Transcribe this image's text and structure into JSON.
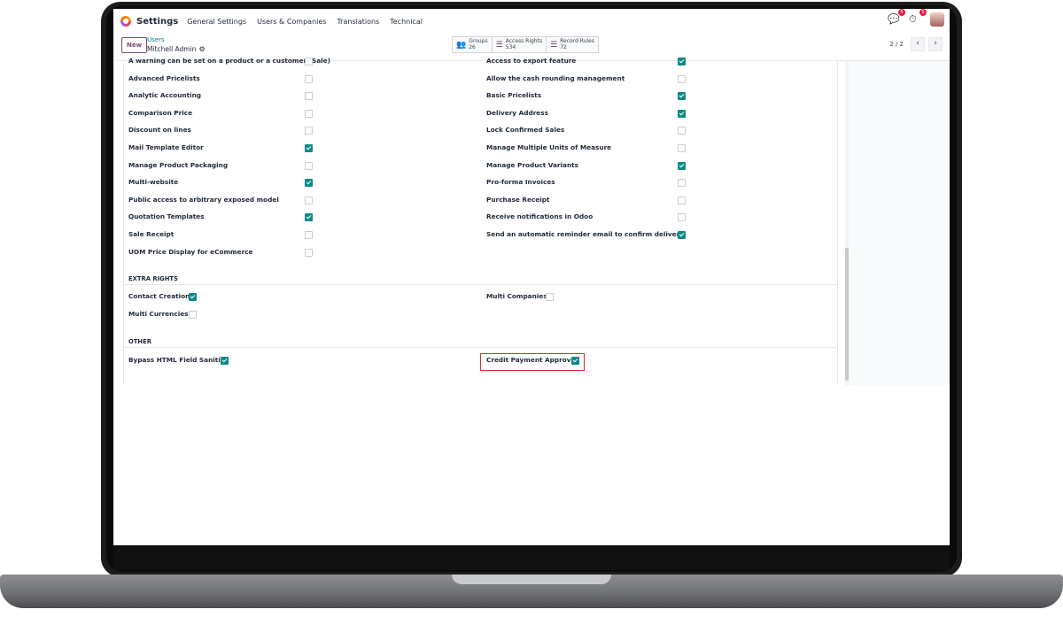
{
  "navbar": {
    "app_title": "Settings",
    "links": [
      "General Settings",
      "Users & Companies",
      "Translations",
      "Technical"
    ],
    "messages_badge": "5",
    "activity_badge": "5"
  },
  "control": {
    "new_button": "New",
    "breadcrumb": "Users",
    "record_name": "Mitchell Admin",
    "stats": [
      {
        "label": "Groups",
        "value": "26"
      },
      {
        "label": "Access Rights",
        "value": "534"
      },
      {
        "label": "Record Rules",
        "value": "72"
      }
    ],
    "pager": "2 / 2"
  },
  "technical_left": [
    {
      "label": "A warning can be set on a product or a customer (Sale)",
      "checked": false
    },
    {
      "label": "Advanced Pricelists",
      "checked": false
    },
    {
      "label": "Analytic Accounting",
      "checked": false
    },
    {
      "label": "Comparison Price",
      "checked": false
    },
    {
      "label": "Discount on lines",
      "checked": false
    },
    {
      "label": "Mail Template Editor",
      "checked": true
    },
    {
      "label": "Manage Product Packaging",
      "checked": false
    },
    {
      "label": "Multi-website",
      "checked": true
    },
    {
      "label": "Public access to arbitrary exposed model",
      "checked": false
    },
    {
      "label": "Quotation Templates",
      "checked": true
    },
    {
      "label": "Sale Receipt",
      "checked": false
    },
    {
      "label": "UOM Price Display for eCommerce",
      "checked": false
    }
  ],
  "technical_right": [
    {
      "label": "Access to export feature",
      "checked": true
    },
    {
      "label": "Allow the cash rounding management",
      "checked": false
    },
    {
      "label": "Basic Pricelists",
      "checked": true
    },
    {
      "label": "Delivery Address",
      "checked": true
    },
    {
      "label": "Lock Confirmed Sales",
      "checked": false
    },
    {
      "label": "Manage Multiple Units of Measure",
      "checked": false
    },
    {
      "label": "Manage Product Variants",
      "checked": true
    },
    {
      "label": "Pro-forma Invoices",
      "checked": false
    },
    {
      "label": "Purchase Receipt",
      "checked": false
    },
    {
      "label": "Receive notifications in Odoo",
      "checked": false
    },
    {
      "label": "Send an automatic reminder email to confirm delivery",
      "checked": true
    }
  ],
  "extra_rights": {
    "title": "EXTRA RIGHTS",
    "items": [
      {
        "label": "Contact Creation",
        "checked": true
      },
      {
        "label": "Multi Companies",
        "checked": false
      },
      {
        "label": "Multi Currencies",
        "checked": false
      }
    ]
  },
  "other": {
    "title": "OTHER",
    "items": [
      {
        "label": "Bypass HTML Field Sanitize",
        "checked": true
      },
      {
        "label": "Credit Payment Approval",
        "checked": true
      }
    ]
  }
}
